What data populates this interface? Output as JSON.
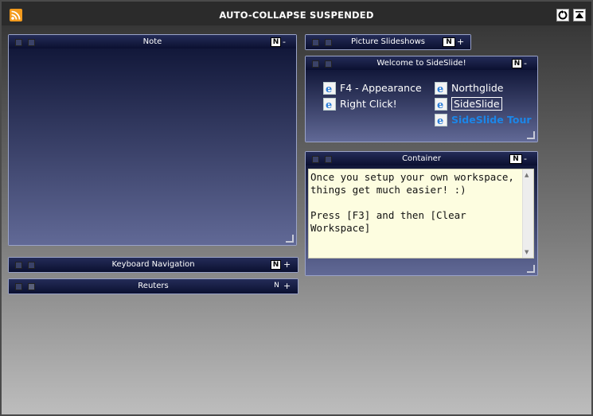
{
  "window": {
    "title": "AUTO-COLLAPSE SUSPENDED",
    "icons": [
      "rss-icon",
      "refresh-icon",
      "expand-up-icon"
    ]
  },
  "panels": {
    "note": {
      "title": "Note",
      "n_label": "N",
      "toggle": "-"
    },
    "keyboard": {
      "title": "Keyboard Navigation",
      "n_label": "N",
      "toggle": "+"
    },
    "reuters": {
      "title": "Reuters",
      "n_label": "N",
      "toggle": "+"
    },
    "slideshows": {
      "title": "Picture Slideshows",
      "n_label": "N",
      "toggle": "+"
    },
    "welcome": {
      "title": "Welcome to SideSlide!",
      "n_label": "N",
      "toggle": "-",
      "links": [
        {
          "label": "F4 - Appearance"
        },
        {
          "label": "Right Click!"
        },
        {
          "label": "Northglide"
        },
        {
          "label": "SideSlide"
        },
        {
          "label": "SideSlide Tour"
        }
      ]
    },
    "container": {
      "title": "Container",
      "n_label": "N",
      "toggle": "-",
      "text_line1": "Once you setup your own workspace,",
      "text_line2": "things get much easier! :)",
      "text_line3": "Press [F3] and then [Clear Workspace]"
    }
  },
  "colors": {
    "accent_tour_link": "#1c86e8",
    "rss": "#f29a1d",
    "panel_bar": "#0b1030",
    "note_bg": "#fdfde0"
  }
}
